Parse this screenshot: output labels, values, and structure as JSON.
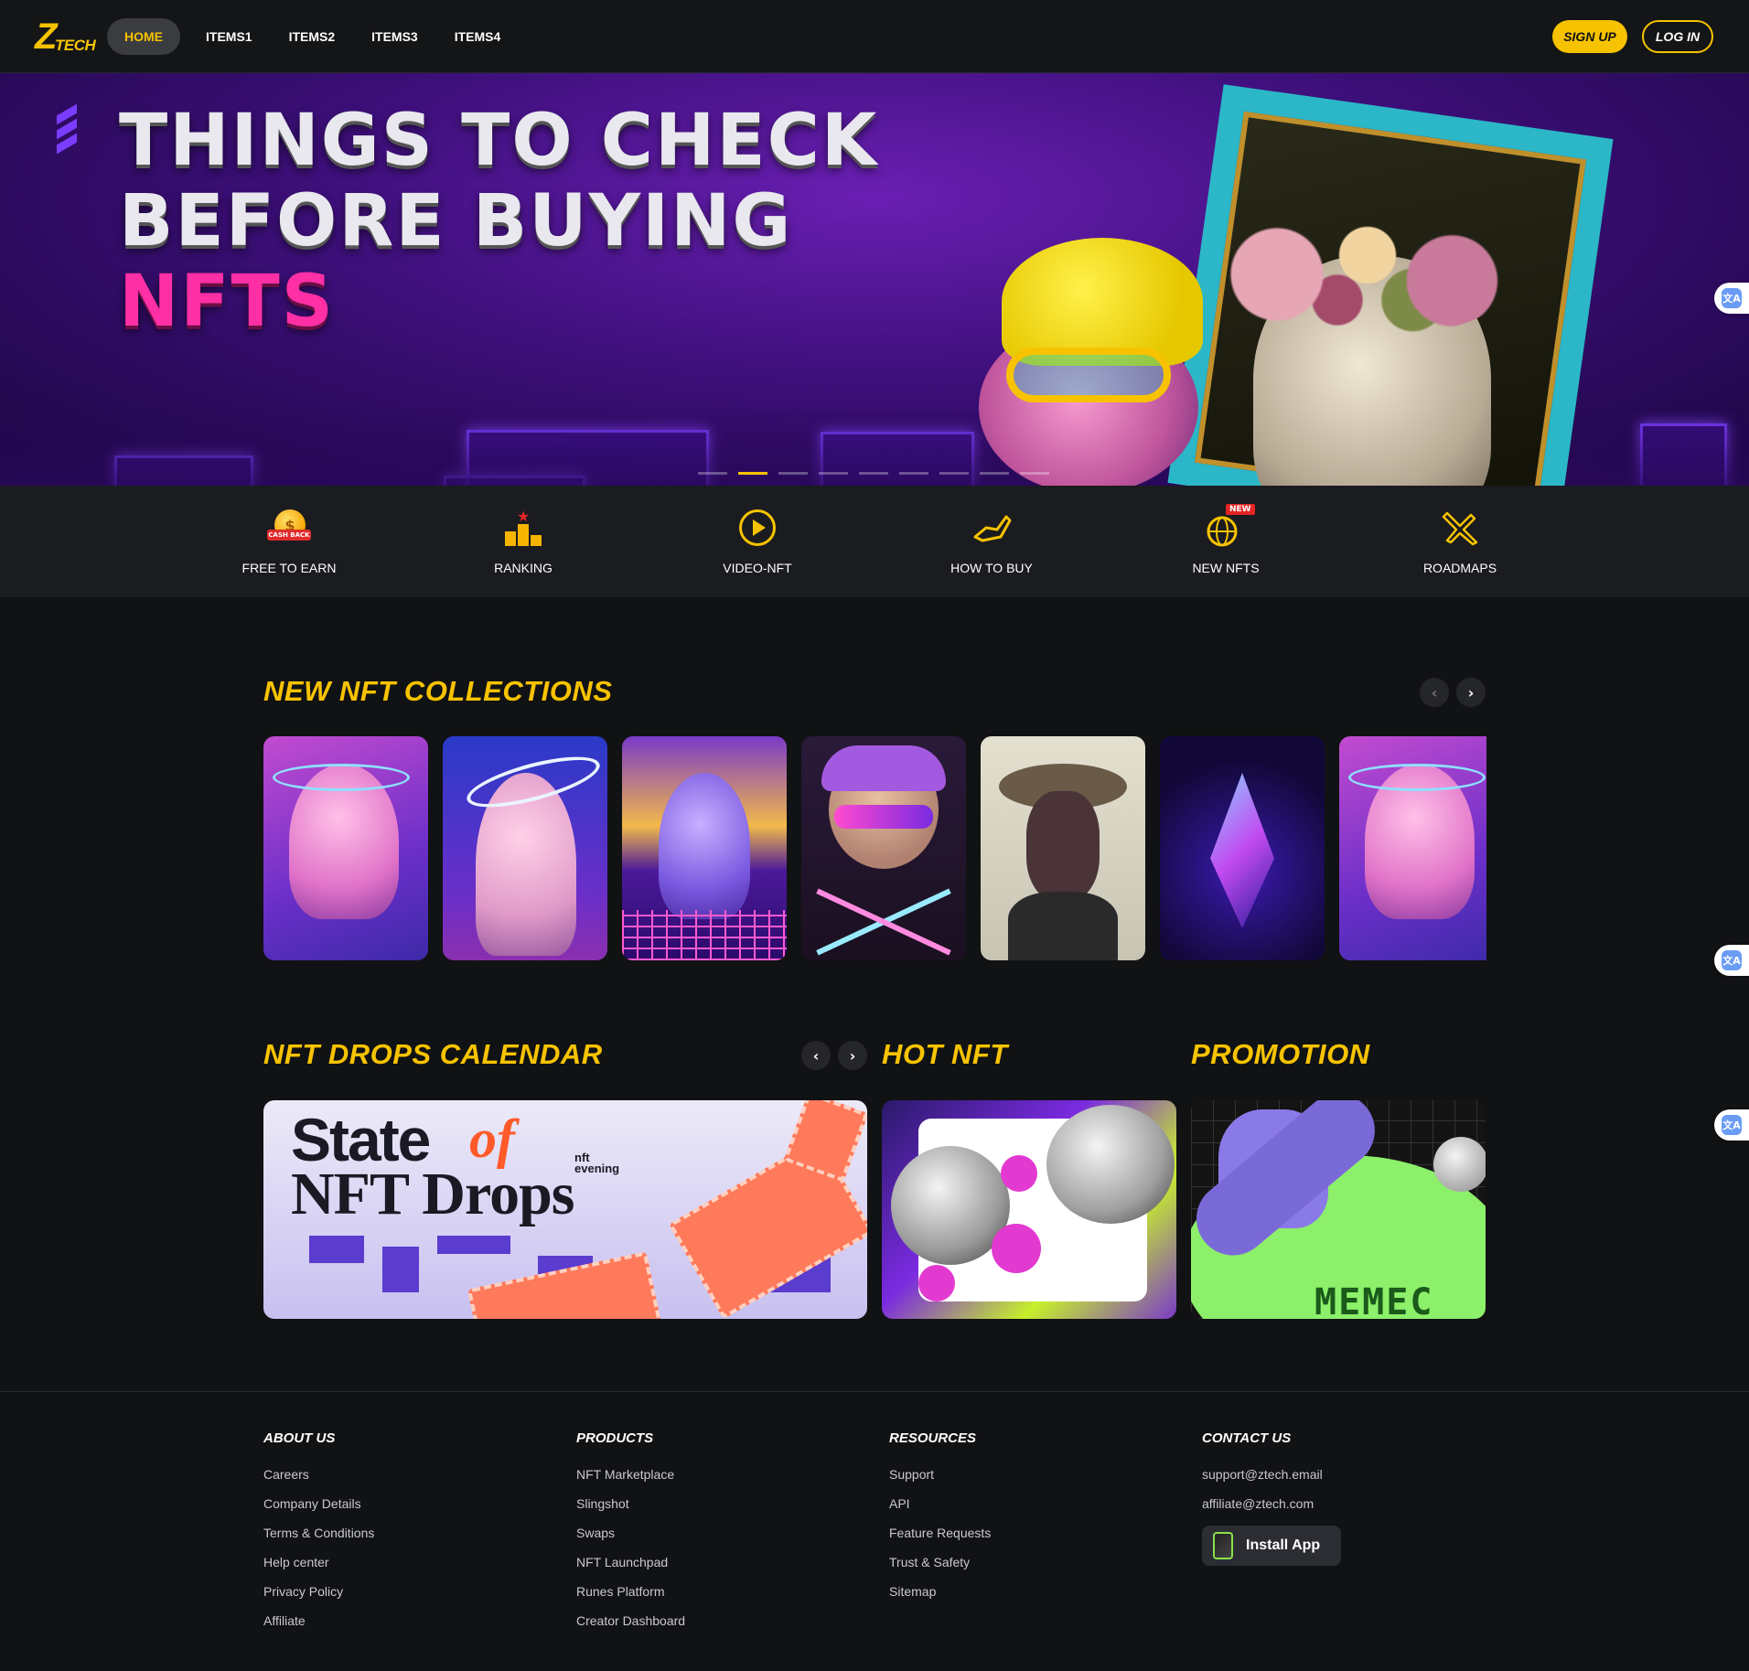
{
  "header": {
    "logo_mark": "Z",
    "logo_text": "TECH",
    "nav": [
      "HOME",
      "ITEMS1",
      "ITEMS2",
      "ITEMS3",
      "ITEMS4"
    ],
    "active_nav": "HOME",
    "signup": "SIGN UP",
    "login": "LOG IN"
  },
  "hero": {
    "line1": "THINGS TO CHECK",
    "line2": "BEFORE BUYING",
    "line3": "NFTS",
    "slides_total": 9,
    "active_slide": 2
  },
  "categories": [
    {
      "label": "FREE TO EARN",
      "icon": "cashback-coin-icon",
      "badge": "CASH BACK"
    },
    {
      "label": "RANKING",
      "icon": "ranking-podium-icon"
    },
    {
      "label": "VIDEO-NFT",
      "icon": "play-icon"
    },
    {
      "label": "HOW TO BUY",
      "icon": "hand-icon"
    },
    {
      "label": "NEW NFTS",
      "icon": "globe-icon",
      "badge": "NEW"
    },
    {
      "label": "ROADMAPS",
      "icon": "airplane-icon"
    }
  ],
  "collections": {
    "title": "NEW NFT COLLECTIONS",
    "prev": "‹",
    "next": "›"
  },
  "drops": {
    "title": "NFT DROPS CALENDAR",
    "prev": "‹",
    "next": "›",
    "banner_line1": "State",
    "banner_of": "of",
    "banner_line2": "NFT Drops",
    "banner_brand_1": "nft",
    "banner_brand_2": "evening"
  },
  "hot": {
    "title": "HOT NFT"
  },
  "promotion": {
    "title": "PROMOTION",
    "banner_text": "MEMEC"
  },
  "footer": {
    "about": {
      "title": "ABOUT US",
      "links": [
        "Careers",
        "Company Details",
        "Terms & Conditions",
        "Help center",
        "Privacy Policy",
        "Affiliate"
      ]
    },
    "products": {
      "title": "PRODUCTS",
      "links": [
        "NFT Marketplace",
        "Slingshot",
        "Swaps",
        "NFT Launchpad",
        "Runes Platform",
        "Creator Dashboard"
      ]
    },
    "resources": {
      "title": "RESOURCES",
      "links": [
        "Support",
        "API",
        "Feature Requests",
        "Trust & Safety",
        "Sitemap"
      ]
    },
    "contact": {
      "title": "CONTACT US",
      "links": [
        "support@ztech.email",
        "affiliate@ztech.com"
      ],
      "install": "Install App"
    }
  },
  "colors": {
    "accent": "#f7c300",
    "background": "#111214",
    "hero_pink": "#ff2fa5"
  }
}
